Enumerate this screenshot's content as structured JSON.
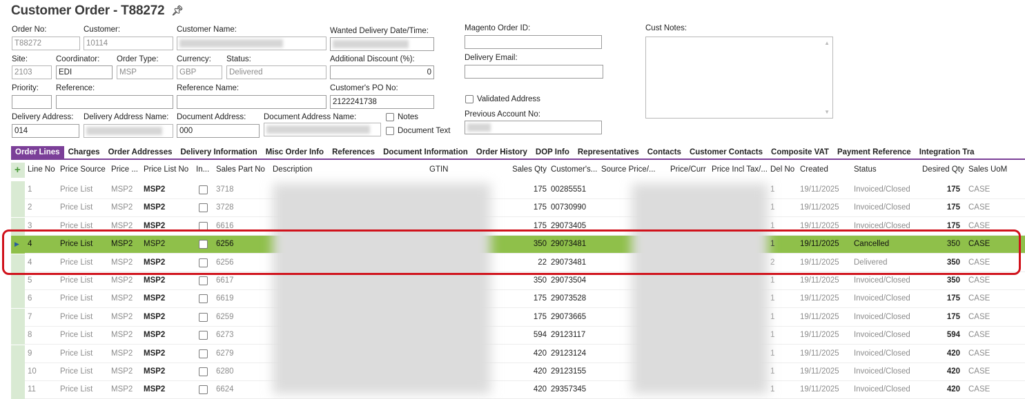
{
  "page": {
    "title": "Customer Order - T88272"
  },
  "form": {
    "order_no": {
      "label": "Order No:",
      "value": "T88272"
    },
    "customer": {
      "label": "Customer:",
      "value": "10114"
    },
    "customer_name": {
      "label": "Customer Name:"
    },
    "wanted_delivery": {
      "label": "Wanted Delivery Date/Time:"
    },
    "magento_order_id": {
      "label": "Magento Order ID:",
      "value": ""
    },
    "cust_notes": {
      "label": "Cust Notes:"
    },
    "site": {
      "label": "Site:",
      "value": "2103"
    },
    "coordinator": {
      "label": "Coordinator:",
      "value": "EDI"
    },
    "order_type": {
      "label": "Order Type:",
      "value": "MSP"
    },
    "currency": {
      "label": "Currency:",
      "value": "GBP"
    },
    "status": {
      "label": "Status:",
      "value": "Delivered"
    },
    "additional_discount": {
      "label": "Additional Discount (%):",
      "value": "0"
    },
    "delivery_email": {
      "label": "Delivery Email:",
      "value": ""
    },
    "priority": {
      "label": "Priority:",
      "value": ""
    },
    "reference": {
      "label": "Reference:",
      "value": ""
    },
    "reference_name": {
      "label": "Reference Name:",
      "value": ""
    },
    "customer_po_no": {
      "label": "Customer's PO No:",
      "value": "2122241738"
    },
    "validated_address": {
      "label": "Validated Address"
    },
    "previous_account_no": {
      "label": "Previous Account No:"
    },
    "delivery_address": {
      "label": "Delivery Address:",
      "value": "014"
    },
    "delivery_address_name": {
      "label": "Delivery Address Name:"
    },
    "document_address": {
      "label": "Document Address:",
      "value": "000"
    },
    "document_address_name": {
      "label": "Document Address Name:"
    },
    "notes": {
      "label": "Notes"
    },
    "document_text": {
      "label": "Document Text"
    }
  },
  "tabs": [
    "Order Lines",
    "Charges",
    "Order Addresses",
    "Delivery Information",
    "Misc Order Info",
    "References",
    "Document Information",
    "Order History",
    "DOP Info",
    "Representatives",
    "Contacts",
    "Customer Contacts",
    "Composite VAT",
    "Payment Reference",
    "Integration Tra"
  ],
  "grid": {
    "columns": [
      "Line No",
      "Price Source",
      "Price ...",
      "Price List No",
      "In...",
      "Sales Part No",
      "Description",
      "GTIN",
      "Sales Qty",
      "Customer's...",
      "Source Price/...",
      "Price/Curr",
      "Price Incl Tax/...",
      "Del No",
      "Created",
      "Status",
      "Desired Qty",
      "Sales UoM"
    ],
    "rows": [
      {
        "line_no": "1",
        "price_source": "Price List",
        "price": "MSP2",
        "price_list_no": "MSP2",
        "sales_part_no": "3718",
        "sales_qty": "175",
        "customers": "00285551",
        "del_no": "1",
        "created": "19/11/2025",
        "status": "Invoiced/Closed",
        "desired_qty": "175",
        "uom": "CASE"
      },
      {
        "line_no": "2",
        "price_source": "Price List",
        "price": "MSP2",
        "price_list_no": "MSP2",
        "sales_part_no": "3728",
        "sales_qty": "175",
        "customers": "00730990",
        "del_no": "1",
        "created": "19/11/2025",
        "status": "Invoiced/Closed",
        "desired_qty": "175",
        "uom": "CASE"
      },
      {
        "line_no": "3",
        "price_source": "Price List",
        "price": "MSP2",
        "price_list_no": "MSP2",
        "sales_part_no": "6616",
        "sales_qty": "175",
        "customers": "29073405",
        "del_no": "1",
        "created": "19/11/2025",
        "status": "Invoiced/Closed",
        "desired_qty": "175",
        "uom": "CASE"
      },
      {
        "line_no": "4",
        "price_source": "Price List",
        "price": "MSP2",
        "price_list_no": "MSP2",
        "sales_part_no": "6256",
        "sales_qty": "350",
        "customers": "29073481",
        "del_no": "1",
        "created": "19/11/2025",
        "status": "Cancelled",
        "desired_qty": "350",
        "uom": "CASE"
      },
      {
        "line_no": "4",
        "price_source": "Price List",
        "price": "MSP2",
        "price_list_no": "MSP2",
        "sales_part_no": "6256",
        "sales_qty": "22",
        "customers": "29073481",
        "del_no": "2",
        "created": "19/11/2025",
        "status": "Delivered",
        "desired_qty": "350",
        "uom": "CASE"
      },
      {
        "line_no": "5",
        "price_source": "Price List",
        "price": "MSP2",
        "price_list_no": "MSP2",
        "sales_part_no": "6617",
        "sales_qty": "350",
        "customers": "29073504",
        "del_no": "1",
        "created": "19/11/2025",
        "status": "Invoiced/Closed",
        "desired_qty": "350",
        "uom": "CASE"
      },
      {
        "line_no": "6",
        "price_source": "Price List",
        "price": "MSP2",
        "price_list_no": "MSP2",
        "sales_part_no": "6619",
        "sales_qty": "175",
        "customers": "29073528",
        "del_no": "1",
        "created": "19/11/2025",
        "status": "Invoiced/Closed",
        "desired_qty": "175",
        "uom": "CASE"
      },
      {
        "line_no": "7",
        "price_source": "Price List",
        "price": "MSP2",
        "price_list_no": "MSP2",
        "sales_part_no": "6259",
        "sales_qty": "175",
        "customers": "29073665",
        "del_no": "1",
        "created": "19/11/2025",
        "status": "Invoiced/Closed",
        "desired_qty": "175",
        "uom": "CASE"
      },
      {
        "line_no": "8",
        "price_source": "Price List",
        "price": "MSP2",
        "price_list_no": "MSP2",
        "sales_part_no": "6273",
        "sales_qty": "594",
        "customers": "29123117",
        "del_no": "1",
        "created": "19/11/2025",
        "status": "Invoiced/Closed",
        "desired_qty": "594",
        "uom": "CASE"
      },
      {
        "line_no": "9",
        "price_source": "Price List",
        "price": "MSP2",
        "price_list_no": "MSP2",
        "sales_part_no": "6279",
        "sales_qty": "420",
        "customers": "29123124",
        "del_no": "1",
        "created": "19/11/2025",
        "status": "Invoiced/Closed",
        "desired_qty": "420",
        "uom": "CASE"
      },
      {
        "line_no": "10",
        "price_source": "Price List",
        "price": "MSP2",
        "price_list_no": "MSP2",
        "sales_part_no": "6280",
        "sales_qty": "420",
        "customers": "29123155",
        "del_no": "1",
        "created": "19/11/2025",
        "status": "Invoiced/Closed",
        "desired_qty": "420",
        "uom": "CASE"
      },
      {
        "line_no": "11",
        "price_source": "Price List",
        "price": "MSP2",
        "price_list_no": "MSP2",
        "sales_part_no": "6624",
        "sales_qty": "420",
        "customers": "29357345",
        "del_no": "1",
        "created": "19/11/2025",
        "status": "Invoiced/Closed",
        "desired_qty": "420",
        "uom": "CASE"
      }
    ],
    "selected_row": 3
  },
  "colors": {
    "tab_accent": "#7b3f98",
    "selected_row": "#8fc04a",
    "highlight_border": "#d0121b"
  }
}
